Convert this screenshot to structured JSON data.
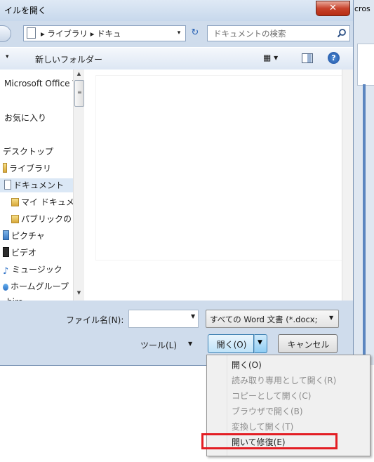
{
  "window": {
    "title": "イルを開く",
    "close_glyph": "✕",
    "background_app_title": "cros"
  },
  "address_bar": {
    "path": "▸ ライブラリ ▸ ドキュ",
    "dropdown_glyph": "▾",
    "refresh_glyph": "↻"
  },
  "search": {
    "placeholder": "ドキュメントの検索",
    "icon": "search-icon"
  },
  "toolbar": {
    "new_folder_label": "新しいフォルダー",
    "view_glyph": "▦ ▾",
    "help_glyph": "?"
  },
  "nav_pane": {
    "items": [
      {
        "label": "Microsoft Office V",
        "icon": "office-icon"
      },
      {
        "label": "お気に入り",
        "icon": "favorites-icon"
      },
      {
        "label": "デスクトップ",
        "icon": "desktop-icon"
      },
      {
        "label": "ライブラリ",
        "icon": "library-icon"
      },
      {
        "label": "ドキュメント",
        "icon": "documents-icon",
        "selected": true
      },
      {
        "label": "マイ ドキュメ",
        "icon": "folder-icon"
      },
      {
        "label": "パブリックの",
        "icon": "folder-icon"
      },
      {
        "label": "ピクチャ",
        "icon": "pictures-icon"
      },
      {
        "label": "ビデオ",
        "icon": "videos-icon"
      },
      {
        "label": "ミュージック",
        "icon": "music-icon"
      },
      {
        "label": "ホームグループ",
        "icon": "homegroup-icon"
      },
      {
        "label": "hiro",
        "icon": "user-icon"
      }
    ]
  },
  "bottom": {
    "filename_label": "ファイル名(N):",
    "filename_value": "",
    "filetype_value": "すべての Word 文書 (*.docx;",
    "tools_label": "ツール(L)",
    "open_label": "開く(O)",
    "cancel_label": "キャンセル"
  },
  "open_menu": {
    "items": [
      {
        "label": "開く(O)",
        "enabled": true
      },
      {
        "label": "読み取り専用として開く(R)",
        "enabled": false
      },
      {
        "label": "コピーとして開く(C)",
        "enabled": false
      },
      {
        "label": "ブラウザで開く(B)",
        "enabled": false
      },
      {
        "label": "変換して開く(T)",
        "enabled": false
      },
      {
        "label": "開いて修復(E)",
        "enabled": true,
        "highlighted": true
      }
    ]
  },
  "colors": {
    "highlight_border": "#e31e24",
    "selected_nav": "#dbe8f6",
    "open_button": "#bfe3f8"
  }
}
